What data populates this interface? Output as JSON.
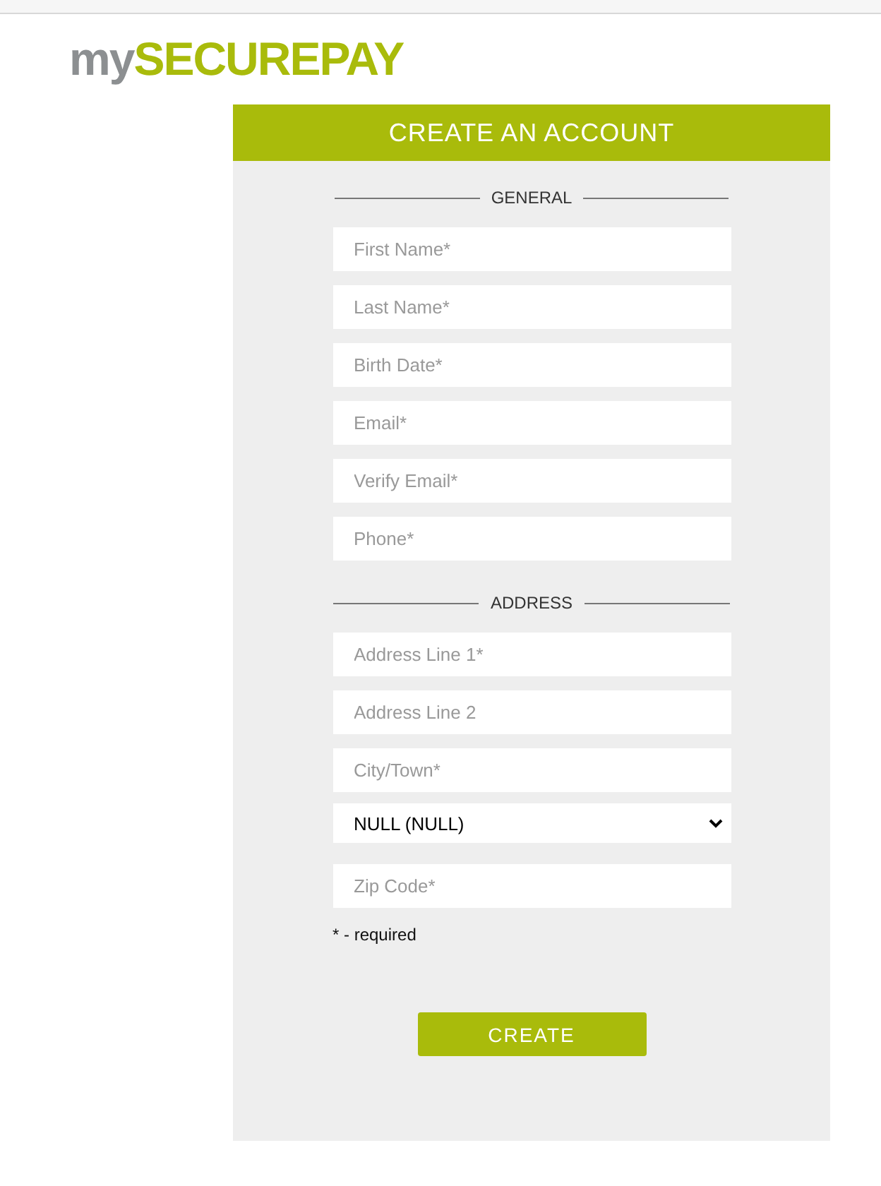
{
  "logo": {
    "prefix": "my",
    "name": "SECUREPAY"
  },
  "form": {
    "title": "CREATE AN ACCOUNT",
    "sections": [
      {
        "heading": "GENERAL",
        "fields": [
          {
            "kind": "text",
            "placeholder": "First Name*"
          },
          {
            "kind": "text",
            "placeholder": "Last Name*"
          },
          {
            "kind": "text",
            "placeholder": "Birth Date*"
          },
          {
            "kind": "text",
            "placeholder": "Email*"
          },
          {
            "kind": "text",
            "placeholder": "Verify Email*"
          },
          {
            "kind": "text",
            "placeholder": "Phone*"
          }
        ]
      },
      {
        "heading": "ADDRESS",
        "fields": [
          {
            "kind": "text",
            "placeholder": "Address Line 1*"
          },
          {
            "kind": "text",
            "placeholder": "Address Line 2"
          },
          {
            "kind": "text",
            "placeholder": "City/Town*"
          },
          {
            "kind": "select",
            "value": "NULL (NULL)"
          },
          {
            "kind": "text",
            "placeholder": "Zip Code*"
          }
        ]
      }
    ],
    "note": "* - required",
    "button": "CREATE"
  }
}
